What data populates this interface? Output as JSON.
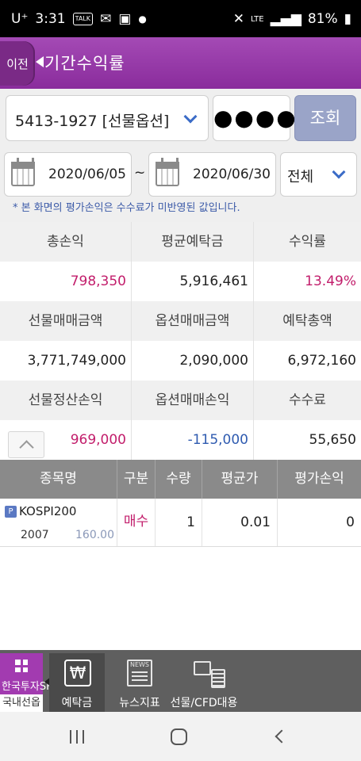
{
  "status_bar": {
    "time": "3:31",
    "carrier": "U⁺",
    "battery": "81%",
    "notif_talk": "TALK",
    "network": "LTE"
  },
  "header": {
    "back_label": "이전",
    "title": "기간수익률"
  },
  "query": {
    "account": "5413-1927 [선물옵션]",
    "password_mask": "●●●●",
    "query_button": "조회"
  },
  "dates": {
    "start": "2020/06/05",
    "separator": "~",
    "end": "2020/06/30",
    "type_filter": "전체"
  },
  "note": "* 본 화면의 평가손익은 수수료가 미반영된 값입니다.",
  "summary": [
    {
      "headers": [
        "총손익",
        "평균예탁금",
        "수익률"
      ],
      "values": [
        "798,350",
        "5,916,461",
        "13.49%"
      ]
    },
    {
      "headers": [
        "선물매매금액",
        "옵션매매금액",
        "예탁총액"
      ],
      "values": [
        "3,771,749,000",
        "2,090,000",
        "6,972,160"
      ]
    },
    {
      "headers": [
        "선물정산손익",
        "옵션매매손익",
        "수수료"
      ],
      "values": [
        "969,000",
        "-115,000",
        "55,650"
      ]
    }
  ],
  "positions": {
    "columns": [
      "종목명",
      "구분",
      "수량",
      "평균가",
      "평가손익"
    ],
    "rows": [
      {
        "badge": "P",
        "name": "KOSPI200",
        "code": "2007",
        "strike": "160.00",
        "side": "매수",
        "qty": "1",
        "avg_price": "0.01",
        "eval_pnl": "0"
      }
    ]
  },
  "bottom_nav": {
    "menu_logo": "한국투자SF",
    "menu_sub": "국내선옵",
    "items": [
      {
        "label": "예탁금",
        "icon": "won-icon",
        "active": true
      },
      {
        "label": "뉴스지표",
        "icon": "news-icon",
        "active": false
      },
      {
        "label": "선물/CFD대용",
        "icon": "cfd-collateral-icon",
        "active": false
      }
    ],
    "news_icon_text": "NEWS"
  },
  "colors": {
    "accent_purple": "#9a3fad",
    "positive": "#c21d6b",
    "negative": "#2f5bb0",
    "query_button": "#9aa4c8"
  }
}
